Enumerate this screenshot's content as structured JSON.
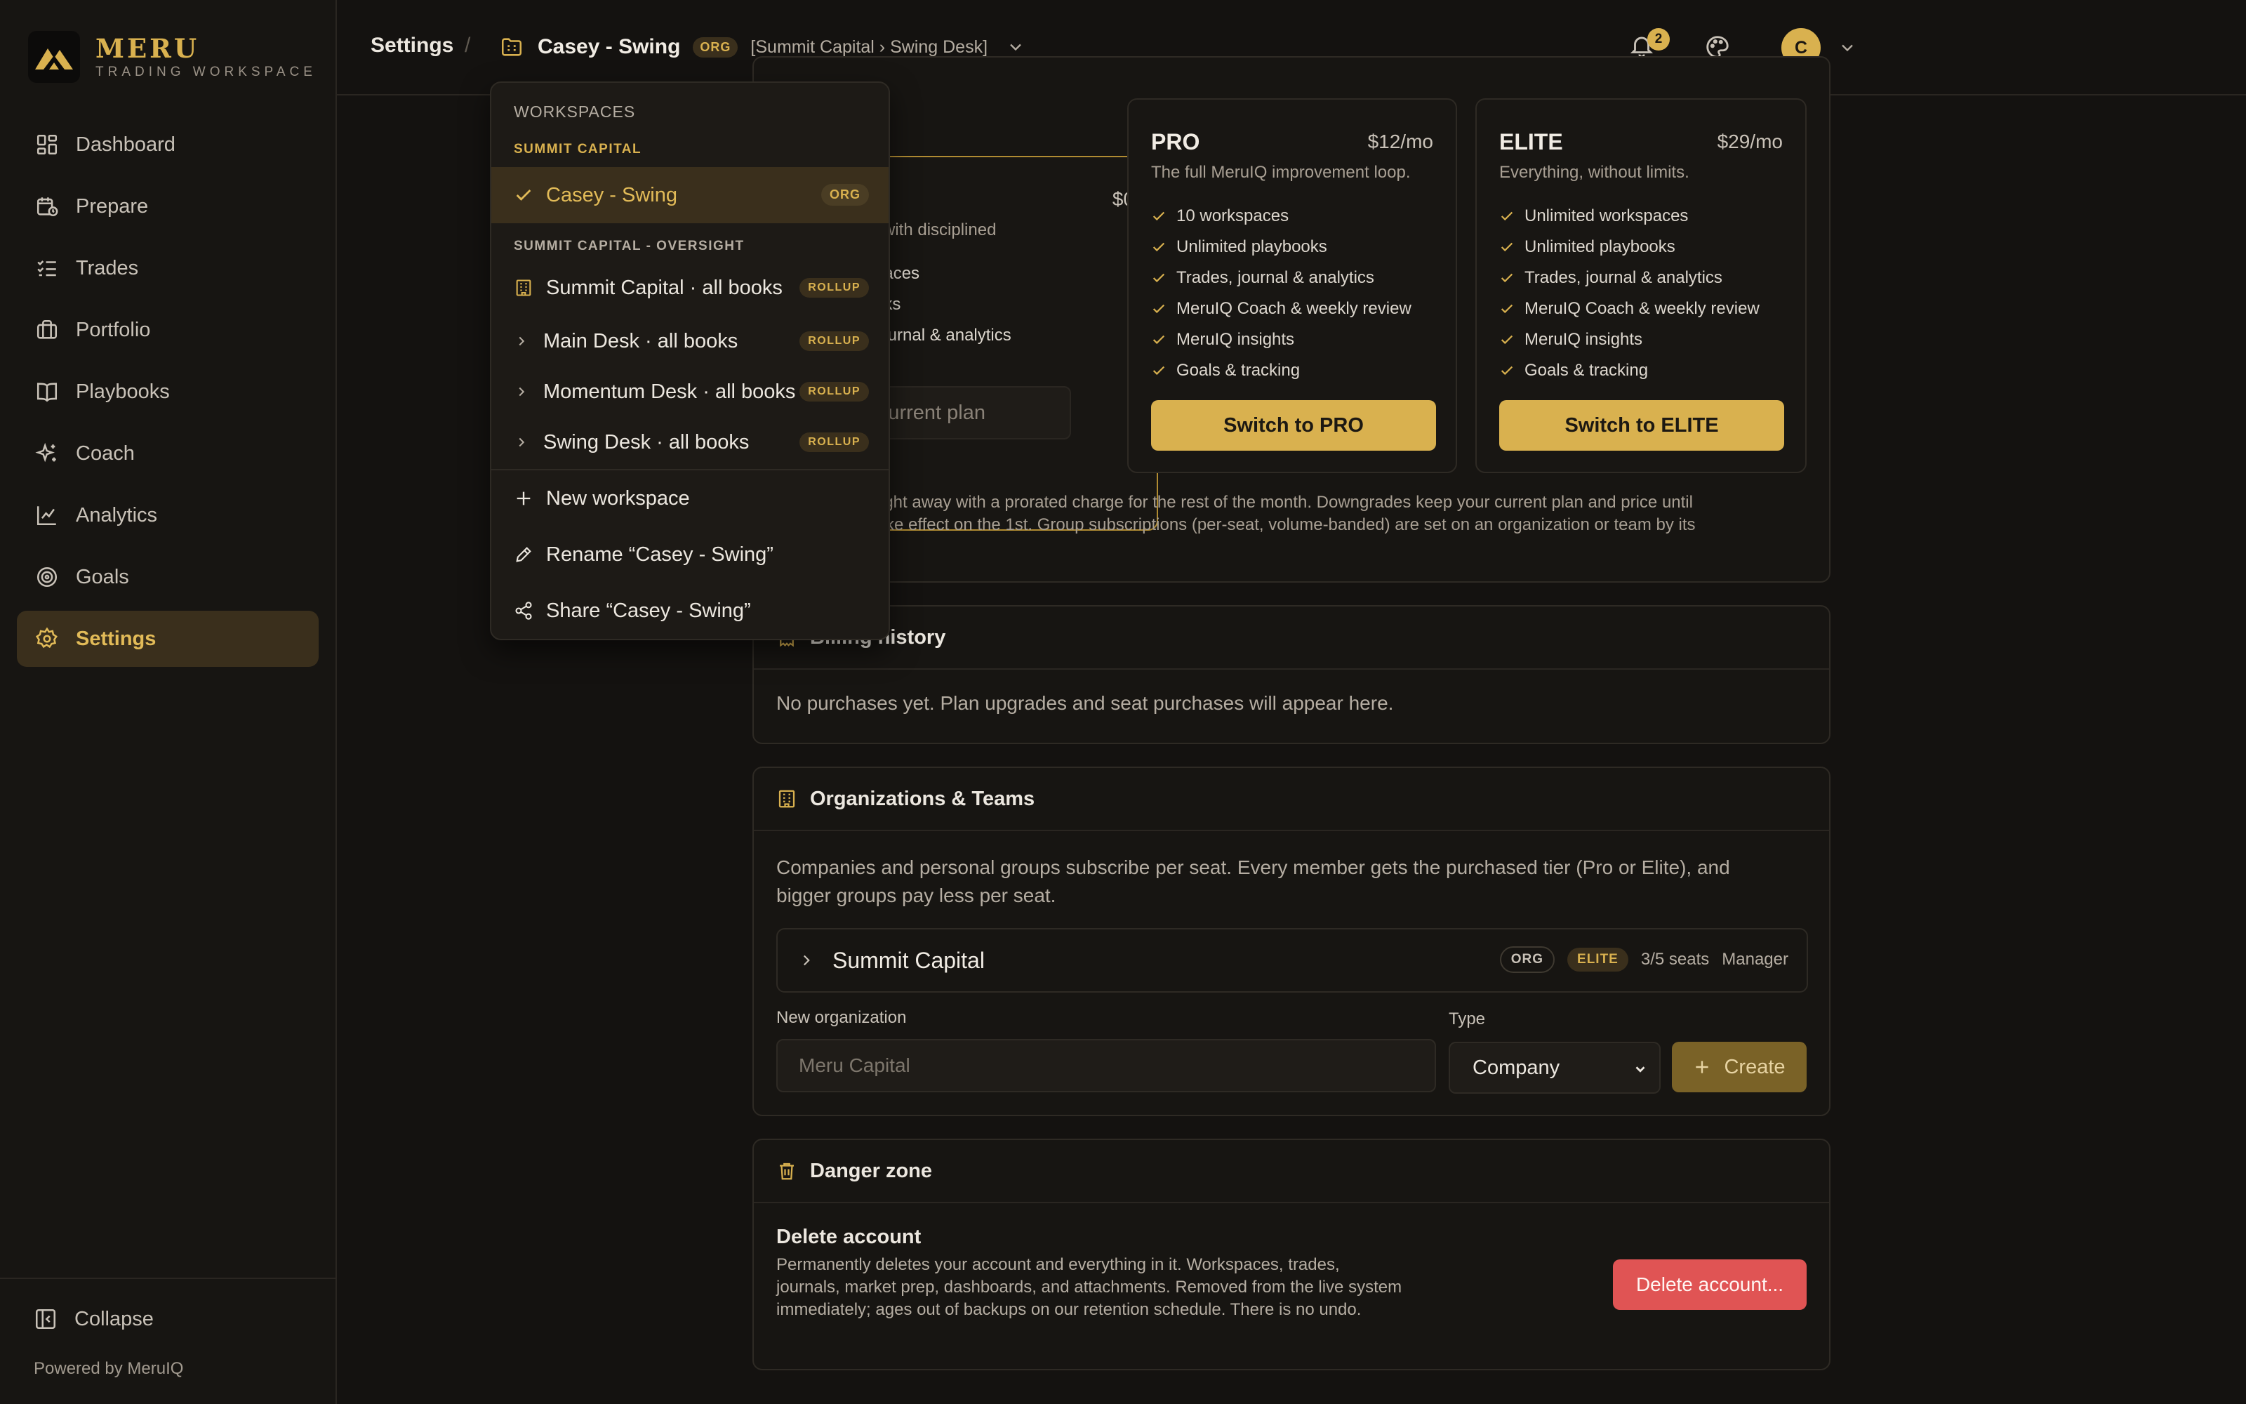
{
  "brand": {
    "name": "MERU",
    "tagline": "TRADING WORKSPACE"
  },
  "sidebar": {
    "items": [
      {
        "label": "Dashboard",
        "icon": "dashboard-icon"
      },
      {
        "label": "Prepare",
        "icon": "calendar-clock-icon"
      },
      {
        "label": "Trades",
        "icon": "list-checks-icon"
      },
      {
        "label": "Portfolio",
        "icon": "briefcase-icon"
      },
      {
        "label": "Playbooks",
        "icon": "book-icon"
      },
      {
        "label": "Coach",
        "icon": "sparkles-icon"
      },
      {
        "label": "Analytics",
        "icon": "line-chart-icon"
      },
      {
        "label": "Goals",
        "icon": "target-icon"
      },
      {
        "label": "Settings",
        "icon": "gear-icon",
        "active": true
      }
    ],
    "collapse_label": "Collapse",
    "powered_by": "Powered by MeruIQ"
  },
  "topbar": {
    "breadcrumb_settings": "Settings",
    "separator": "/",
    "workspace_name": "Casey - Swing",
    "workspace_badge": "ORG",
    "workspace_path": "[Summit Capital › Swing Desk]",
    "notification_count": "2",
    "avatar_initial": "C"
  },
  "plans": {
    "current": {
      "price": "$0",
      "desc_fragment": "with disciplined",
      "features_fragments": [
        "paces",
        "oks",
        "journal & analytics"
      ],
      "button": "Current plan"
    },
    "pro": {
      "name": "PRO",
      "price": "$12/mo",
      "desc": "The full MeruIQ improvement loop.",
      "features": [
        "10 workspaces",
        "Unlimited playbooks",
        "Trades, journal & analytics",
        "MeruIQ Coach & weekly review",
        "MeruIQ insights",
        "Goals & tracking"
      ],
      "button": "Switch to PRO"
    },
    "elite": {
      "name": "ELITE",
      "price": "$29/mo",
      "desc": "Everything, without limits.",
      "features": [
        "Unlimited workspaces",
        "Unlimited playbooks",
        "Trades, journal & analytics",
        "MeruIQ Coach & weekly review",
        "MeruIQ insights",
        "Goals & tracking"
      ],
      "button": "Switch to ELITE"
    },
    "footnote_line1": "ly right away with a prorated charge for the rest of the month. Downgrades keep your current plan and price until",
    "footnote_line2": "d take effect on the 1st. Group subscriptions (per-seat, volume-banded) are set on an organization or team by its"
  },
  "billing": {
    "title_fragment": "Billing history",
    "empty": "No purchases yet. Plan upgrades and seat purchases will appear here."
  },
  "orgs": {
    "title": "Organizations & Teams",
    "desc_line1": "Companies and personal groups subscribe per seat. Every member gets the purchased tier (Pro or Elite), and",
    "desc_line2": "bigger groups pay less per seat.",
    "row": {
      "name": "Summit Capital",
      "tag_org": "ORG",
      "tag_tier": "ELITE",
      "seats": "3/5 seats",
      "role": "Manager"
    },
    "new_org_label": "New organization",
    "new_org_placeholder": "Meru Capital",
    "type_label": "Type",
    "type_value": "Company",
    "create_label": "Create"
  },
  "danger": {
    "title": "Danger zone",
    "delete_title": "Delete account",
    "delete_desc": "Permanently deletes your account and everything in it. Workspaces, trades, journals, market prep, dashboards, and attachments. Removed from the live system immediately; ages out of backups on our retention schedule. There is no undo.",
    "delete_button": "Delete account..."
  },
  "dropdown": {
    "heading": "WORKSPACES",
    "group1": "SUMMIT CAPITAL",
    "selected_item": "Casey - Swing",
    "selected_badge": "ORG",
    "group2": "SUMMIT CAPITAL - OVERSIGHT",
    "rollups": [
      {
        "label": "Summit Capital · all books",
        "badge": "ROLLUP"
      },
      {
        "label": "Main Desk · all books",
        "badge": "ROLLUP"
      },
      {
        "label": "Momentum Desk · all books",
        "badge": "ROLLUP"
      },
      {
        "label": "Swing Desk · all books",
        "badge": "ROLLUP"
      }
    ],
    "actions": {
      "new": "New workspace",
      "rename": "Rename “Casey - Swing”",
      "share": "Share “Casey - Swing”"
    }
  },
  "colors": {
    "accent": "#d9b14f",
    "background": "#141210",
    "danger": "#e05454"
  }
}
